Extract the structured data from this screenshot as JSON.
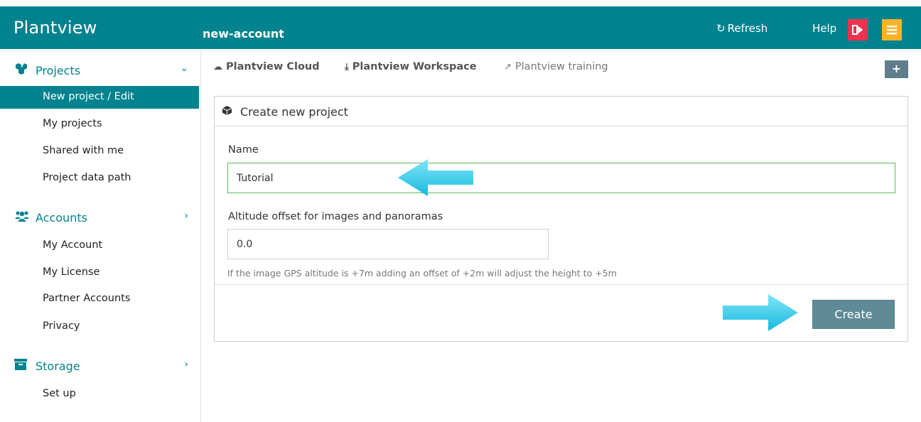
{
  "app": {
    "title": "Plantview",
    "account": "new-account"
  },
  "header": {
    "refresh_label": "Refresh",
    "help_label": "Help",
    "refresh_icon": "refresh-icon",
    "exit_icon": "sign-out-icon",
    "menu_icon": "hamburger-menu-icon"
  },
  "sidebar": {
    "sections": [
      {
        "label": "Projects",
        "icon": "cubes-icon",
        "expanded": true,
        "items": [
          {
            "label": "New project / Edit",
            "active": true
          },
          {
            "label": "My projects"
          },
          {
            "label": "Shared with me"
          },
          {
            "label": "Project data path"
          }
        ]
      },
      {
        "label": "Accounts",
        "icon": "users-icon",
        "expanded": false,
        "items": [
          {
            "label": "My Account"
          },
          {
            "label": "My License"
          },
          {
            "label": "Partner Accounts"
          },
          {
            "label": "Privacy"
          }
        ]
      },
      {
        "label": "Storage",
        "icon": "archive-box-icon",
        "expanded": false,
        "items": [
          {
            "label": "Set up"
          }
        ]
      }
    ]
  },
  "toplinks": [
    {
      "label": "Plantview Cloud",
      "icon": "cloud-icon"
    },
    {
      "label": "Plantview Workspace",
      "icon": "download-icon"
    },
    {
      "label": "Plantview training",
      "icon": "external-link-icon"
    }
  ],
  "panel": {
    "title": "Create new project",
    "name_label": "Name",
    "name_value": "Tutorial",
    "altitude_label": "Altitude offset for images and panoramas",
    "altitude_value": "0.0",
    "altitude_hint": "If the image GPS altitude is +7m adding an offset of +2m will adjust the height to +5m",
    "create_label": "Create"
  },
  "colors": {
    "teal": "#00838f",
    "exit_red": "#f0304f",
    "menu_amber": "#f7b42a",
    "button_slate": "#5f8a98",
    "arrow_cyan": "#29c8ec"
  }
}
